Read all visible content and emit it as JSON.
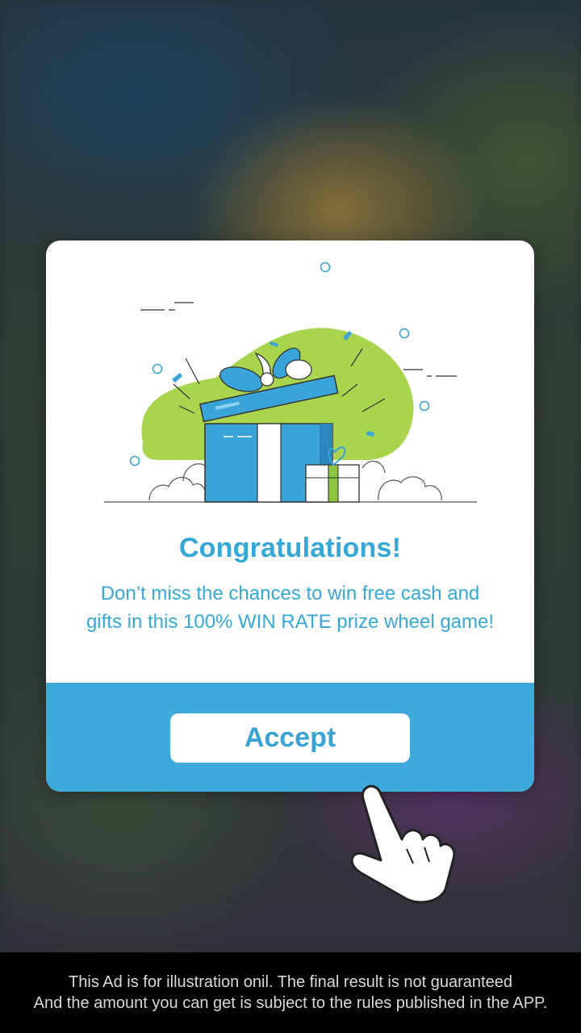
{
  "dialog": {
    "title": "Congratulations!",
    "message": "Don’t miss the chances to win free cash and gifts in this  100% WIN RATE prize wheel game!",
    "accept_label": "Accept",
    "accent_color": "#3eaadb",
    "illustration": "gift-box-illustration"
  },
  "disclaimer": {
    "line1": "This Ad is for illustration onil. The final result is not guaranteed",
    "line2": "And the amount you can get is subject to the rules published in the APP."
  },
  "pointer": "pointing-hand-icon"
}
